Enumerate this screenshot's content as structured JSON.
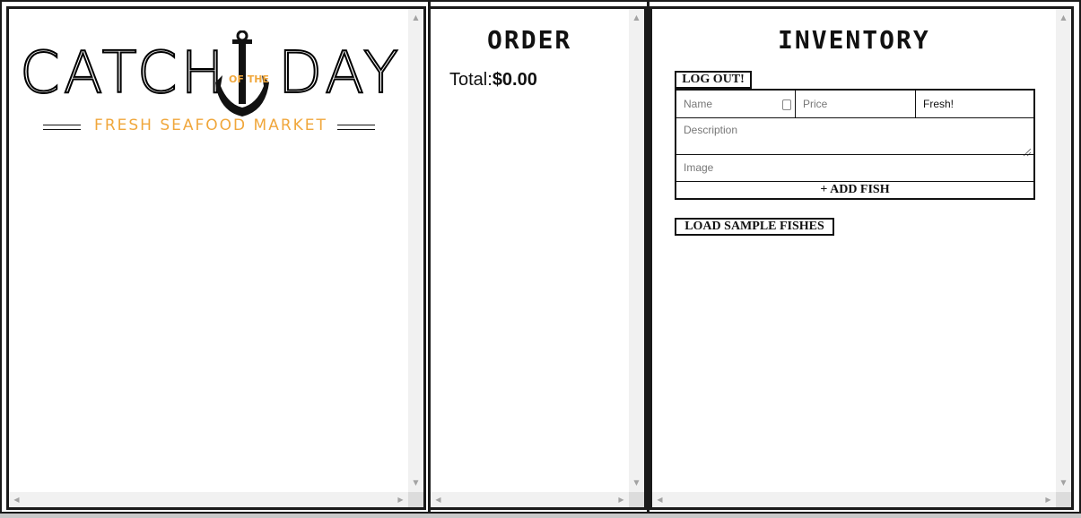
{
  "menu": {
    "logo_word_left": "CATCH",
    "logo_word_right": "DAY",
    "logo_of_the": "OF THE",
    "tagline": "FRESH SEAFOOD MARKET",
    "colors": {
      "brand_orange": "#f0a73c",
      "border": "#1a1a1a"
    },
    "icon": "anchor-icon"
  },
  "order": {
    "title": "ORDER",
    "total_label": "Total:",
    "total_value": "$0.00"
  },
  "inventory": {
    "title": "INVENTORY",
    "logout_label": "LOG OUT!",
    "form": {
      "name_placeholder": "Name",
      "price_placeholder": "Price",
      "status_selected": "Fresh!",
      "description_placeholder": "Description",
      "image_placeholder": "Image",
      "add_button_label": "+ ADD FISH"
    },
    "load_samples_label": "LOAD SAMPLE FISHES"
  }
}
